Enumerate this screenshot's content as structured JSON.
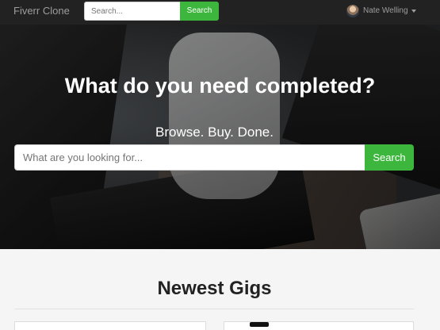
{
  "navbar": {
    "brand": "Fiverr Clone",
    "search_placeholder": "Search...",
    "search_button": "Search",
    "user_name": "Nate Welling",
    "user_icon": "avatar-photo",
    "dropdown_icon": "caret-down-icon"
  },
  "hero": {
    "title": "What do you need completed?",
    "subtitle": "Browse. Buy. Done.",
    "search_placeholder": "What are you looking for...",
    "search_button": "Search"
  },
  "section": {
    "title": "Newest Gigs"
  },
  "colors": {
    "navbar_bg": "#222222",
    "accent_green": "#3cb63c",
    "page_bg": "#f5f5f5"
  }
}
